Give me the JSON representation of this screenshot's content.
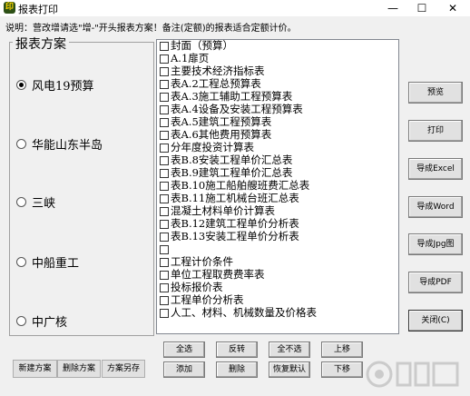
{
  "window": {
    "title": "报表打印",
    "app_icon_glyph": "印",
    "minimize_glyph": "—",
    "maximize_glyph": "☐",
    "close_glyph": "✕"
  },
  "notice": "说明：营改增请选\"增-\"开头报表方案！备注(定额)的报表适合定额计价。",
  "scheme_group": {
    "legend": "报表方案",
    "options": [
      {
        "label": "风电19预算",
        "selected": true
      },
      {
        "label": "华能山东半岛",
        "selected": false
      },
      {
        "label": "三峡",
        "selected": false
      },
      {
        "label": "中船重工",
        "selected": false
      },
      {
        "label": "中广核",
        "selected": false
      }
    ]
  },
  "scheme_buttons": {
    "new": "新建方案",
    "delete": "删除方案",
    "save_as": "方案另存"
  },
  "report_list": [
    "封面（预算）",
    "A.1扉页",
    "主要技术经济指标表",
    "表A.2工程总预算表",
    "表A.3施工辅助工程预算表",
    "表A.4设备及安装工程预算表",
    "表A.5建筑工程预算表",
    "表A.6其他费用预算表",
    "分年度投资计算表",
    "表B.8安装工程单价汇总表",
    "表B.9建筑工程单价汇总表",
    "表B.10施工船舶艘班费汇总表",
    "表B.11施工机械台班汇总表",
    "混凝土材料单价计算表",
    "表B.12建筑工程单价分析表",
    "表B.13安装工程单价分析表",
    "",
    "工程计价条件",
    "单位工程取费费率表",
    "投标报价表",
    "工程单价分析表",
    "人工、材料、机械数量及价格表"
  ],
  "list_buttons": {
    "select_all": "全选",
    "invert": "反转",
    "select_none": "全不选",
    "move_up": "上移",
    "add": "添加",
    "remove": "删除",
    "restore_default": "恢复默认",
    "move_down": "下移"
  },
  "action_buttons": {
    "preview": "预览",
    "print": "打印",
    "export_excel": "导成Excel",
    "export_word": "导成Word",
    "export_jpg": "导成Jpg图",
    "export_pdf": "导成PDF",
    "close": "关闭(C)"
  }
}
